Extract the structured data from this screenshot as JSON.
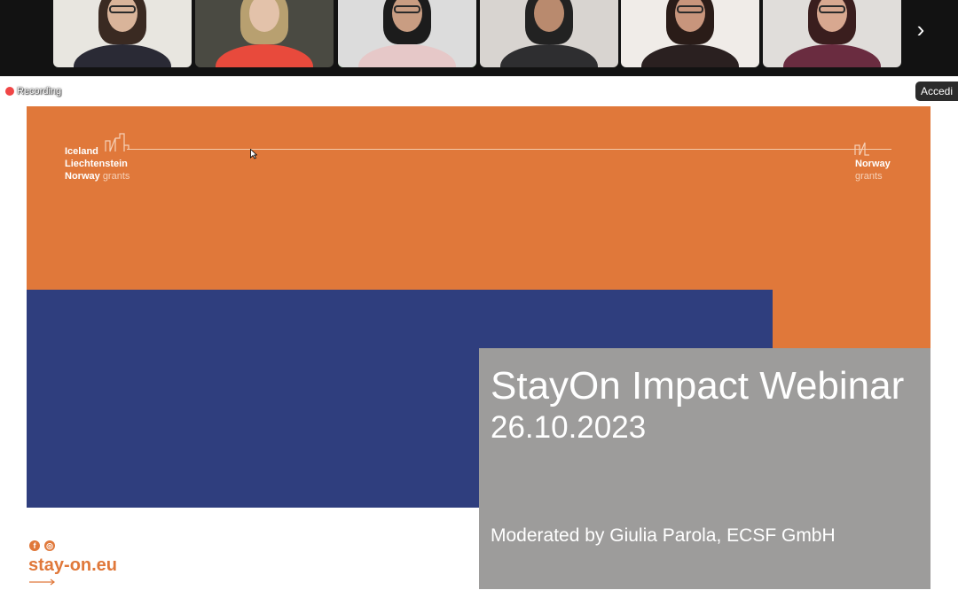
{
  "meeting": {
    "participants": [
      {
        "label": "participant-1",
        "bg": "#e8e6e0",
        "skin": "#d9b49a",
        "hair": "#3a2a22",
        "shirt": "#2a2a35",
        "glasses": true,
        "active": false
      },
      {
        "label": "participant-2",
        "bg": "#4a4a42",
        "skin": "#e3c2aa",
        "hair": "#b8a070",
        "shirt": "#e84a3c",
        "glasses": false,
        "active": false
      },
      {
        "label": "participant-3",
        "bg": "#dcdcdc",
        "skin": "#c99d82",
        "hair": "#1c1c1c",
        "shirt": "#e6c8c8",
        "glasses": true,
        "active": true
      },
      {
        "label": "participant-4",
        "bg": "#d8d4d0",
        "skin": "#b98a6e",
        "hair": "#222222",
        "shirt": "#2e2e30",
        "glasses": false,
        "active": false
      },
      {
        "label": "participant-5",
        "bg": "#f0ece8",
        "skin": "#c8957c",
        "hair": "#2a1c18",
        "shirt": "#2a2020",
        "glasses": true,
        "active": false
      },
      {
        "label": "participant-6",
        "bg": "#e0ddda",
        "skin": "#d8a890",
        "hair": "#3a1e1e",
        "shirt": "#6a2c40",
        "glasses": true,
        "active": false
      }
    ],
    "next_icon": "chevron-right-icon",
    "next_glyph": "›",
    "recording_label": "Recording",
    "accedi_label": "Accedi"
  },
  "slide": {
    "colors": {
      "orange": "#e0783a",
      "blue": "#2f3e7e",
      "grey": "#9d9c9b"
    },
    "eea_logo": {
      "line1": "Iceland",
      "line2": "Liechtenstein",
      "line3_bold": "Norway",
      "line3_light": "grants"
    },
    "norway_logo": {
      "line1": "Norway",
      "line2": "grants"
    },
    "title": "StayOn Impact Webinar",
    "date": "26.10.2023",
    "moderator": "Moderated by Giulia Parola, ECSF GmbH",
    "social": {
      "facebook_glyph": "f",
      "instagram_glyph": "◎"
    },
    "website": "stay-on.eu"
  }
}
